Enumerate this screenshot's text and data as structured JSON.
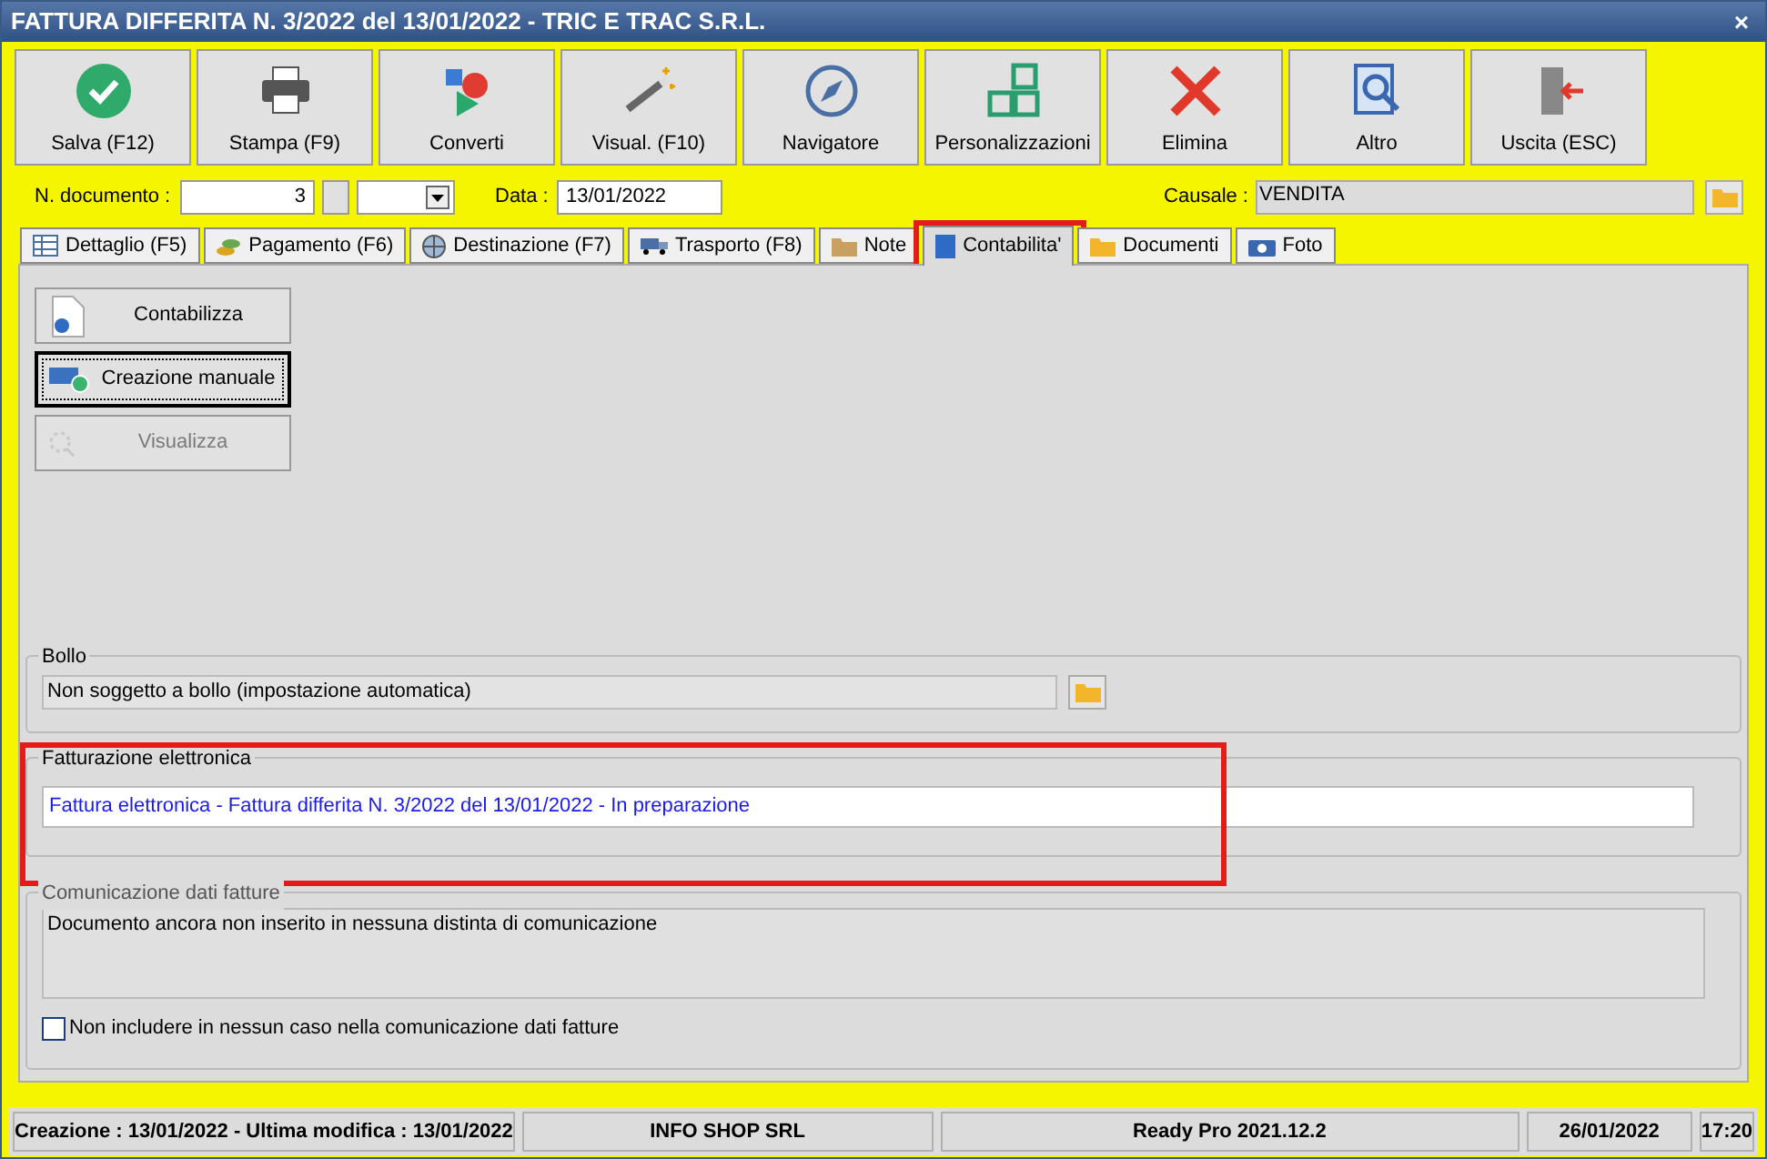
{
  "window": {
    "title": "FATTURA DIFFERITA N. 3/2022 del 13/01/2022 - TRIC E TRAC S.R.L.",
    "close": "×"
  },
  "toolbar": [
    {
      "label": "Salva (F12)"
    },
    {
      "label": "Stampa (F9)"
    },
    {
      "label": "Converti"
    },
    {
      "label": "Visual. (F10)"
    },
    {
      "label": "Navigatore"
    },
    {
      "label": "Personalizzazioni"
    },
    {
      "label": "Elimina"
    },
    {
      "label": "Altro"
    },
    {
      "label": "Uscita (ESC)"
    }
  ],
  "header": {
    "doc_label": "N. documento :",
    "doc_number": "3",
    "date_label": "Data :",
    "date": "13/01/2022",
    "causale_label": "Causale :",
    "causale": "VENDITA"
  },
  "tabs": [
    {
      "label": "Dettaglio (F5)",
      "selected": false,
      "highlighted": false
    },
    {
      "label": "Pagamento (F6)",
      "selected": false,
      "highlighted": false
    },
    {
      "label": "Destinazione (F7)",
      "selected": false,
      "highlighted": false
    },
    {
      "label": "Trasporto (F8)",
      "selected": false,
      "highlighted": false
    },
    {
      "label": "Note",
      "selected": false,
      "highlighted": false
    },
    {
      "label": "Contabilita'",
      "selected": true,
      "highlighted": true
    },
    {
      "label": "Documenti",
      "selected": false,
      "highlighted": false
    },
    {
      "label": "Foto",
      "selected": false,
      "highlighted": false
    }
  ],
  "actions": [
    {
      "label": "Contabilizza",
      "disabled": false,
      "focused": false
    },
    {
      "label": "Creazione manuale",
      "disabled": false,
      "focused": true
    },
    {
      "label": "Visualizza",
      "disabled": true,
      "focused": false
    }
  ],
  "bollo": {
    "title": "Bollo",
    "value": "Non soggetto a bollo (impostazione automatica)"
  },
  "fatturazione": {
    "title": "Fatturazione elettronica",
    "value": "Fattura elettronica - Fattura differita N. 3/2022 del 13/01/2022 - In preparazione",
    "highlighted": true
  },
  "comunicazione": {
    "title": "Comunicazione dati fatture",
    "value": "Documento ancora non inserito in nessuna distinta di comunicazione",
    "checkbox": {
      "label": "Non includere in nessun caso nella comunicazione dati fatture",
      "checked": false
    }
  },
  "status_bar": [
    "Creazione : 13/01/2022 - Ultima modifica : 13/01/2022",
    "INFO SHOP SRL",
    "Ready Pro 2021.12.2",
    "26/01/2022",
    "17:20"
  ]
}
